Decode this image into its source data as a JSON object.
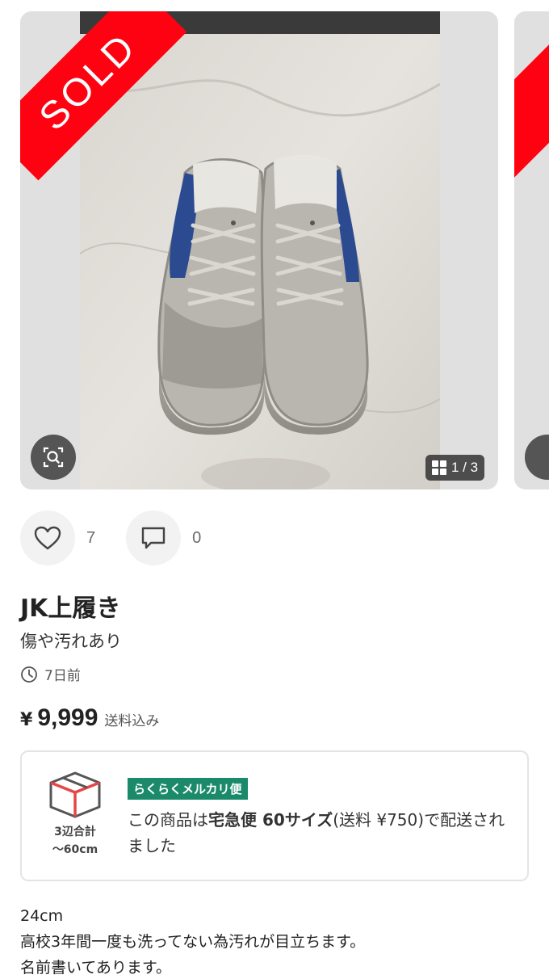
{
  "colors": {
    "sold_red": "#ff0211",
    "badge_green": "#1a8a6b",
    "icon_gray": "#444444"
  },
  "gallery": {
    "sold_label": "SOLD",
    "counter": "1 / 3",
    "zoom_icon": "zoom-search-icon",
    "grid_icon": "grid-icon"
  },
  "actions": {
    "like_count": "7",
    "comment_count": "0"
  },
  "item": {
    "title": "JK上履き",
    "subtitle": "傷や汚れあり",
    "posted": "7日前",
    "currency": "¥",
    "price": "9,999",
    "shipping_included": "送料込み"
  },
  "shipping": {
    "box_label_line1": "3辺合計",
    "box_label_line2": "〜60cm",
    "badge": "らくらくメルカリ便",
    "text_prefix": "この商品は",
    "text_bold": "宅急便 60サイズ",
    "text_suffix": "(送料 ¥750)で配送されました"
  },
  "description": {
    "lines": [
      "24cm",
      "高校3年間一度も洗ってない為汚れが目立ちます。",
      "名前書いてあります。"
    ]
  }
}
